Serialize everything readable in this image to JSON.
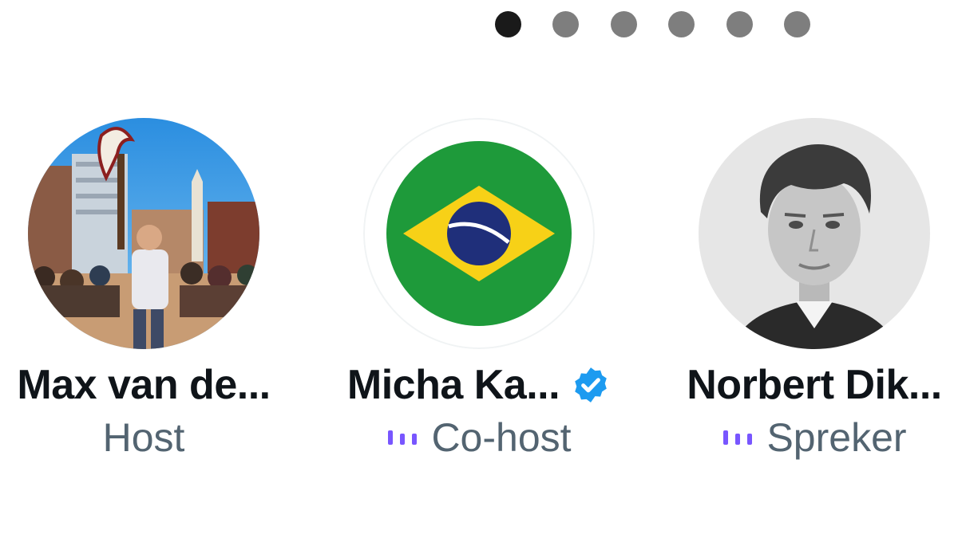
{
  "pager": {
    "count": 6,
    "active_index": 0
  },
  "participants": [
    {
      "name": "Max van de...",
      "role": "Host",
      "verified": false,
      "speaking": false,
      "avatar_icon": "protest-crowd-photo"
    },
    {
      "name": "Micha Ka...",
      "role": "Co-host",
      "verified": true,
      "speaking": true,
      "avatar_icon": "brazil-flag"
    },
    {
      "name": "Norbert Dik...",
      "role": "Spreker",
      "verified": false,
      "speaking": true,
      "avatar_icon": "portrait-photo"
    }
  ],
  "colors": {
    "accent_purple": "#7856ff",
    "verified_blue": "#1d9bf0",
    "name_text": "#0f1419",
    "role_text": "#536471",
    "dot_active": "#1a1a1a",
    "dot_inactive": "#7e7e7e"
  }
}
